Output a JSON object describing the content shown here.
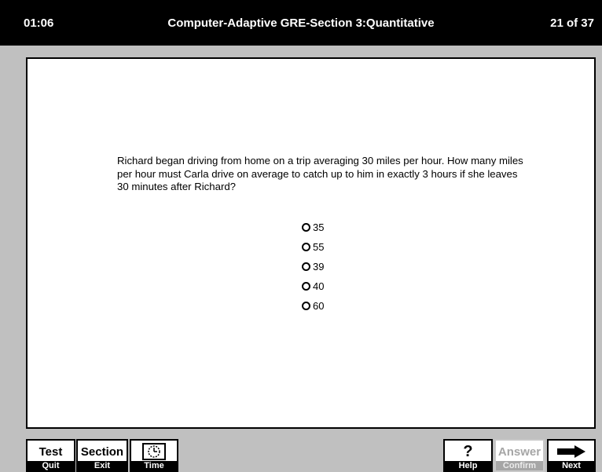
{
  "header": {
    "timer": "01:06",
    "title": "Computer-Adaptive GRE-Section 3:Quantitative",
    "progress": "21 of 37"
  },
  "question": {
    "text": "Richard began driving from home on a trip averaging 30 miles per hour. How many miles per hour must Carla drive on average to catch up to him in exactly 3 hours if she leaves 30 minutes after Richard?",
    "choices": [
      "35",
      "55",
      "39",
      "40",
      "60"
    ]
  },
  "toolbar": {
    "test": {
      "top": "Test",
      "bottom": "Quit"
    },
    "section": {
      "top": "Section",
      "bottom": "Exit"
    },
    "time": {
      "bottom": "Time",
      "icon": "clock-icon"
    },
    "help": {
      "top": "?",
      "bottom": "Help"
    },
    "answer": {
      "top": "Answer",
      "bottom": "Confirm",
      "state": "disabled"
    },
    "next": {
      "bottom": "Next",
      "icon": "right-arrow-icon"
    }
  }
}
